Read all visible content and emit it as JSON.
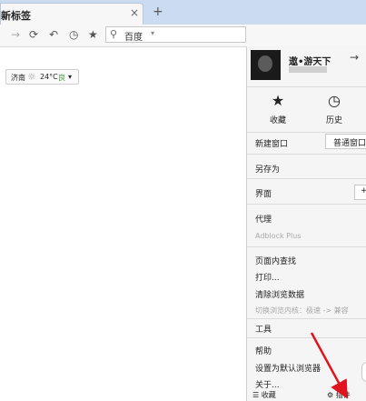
{
  "tab": {
    "title": "新标签",
    "close": "×",
    "new_tab": "+"
  },
  "toolbar": {
    "forward_icon": "→",
    "refresh_icon": "⟳",
    "undo_icon": "↶",
    "history_icon": "◷",
    "favorite_icon": "★",
    "search_icon": "⚲",
    "search_engine": "百度",
    "search_caret": "▾"
  },
  "weather": {
    "city": "济南",
    "icon": "☼",
    "temp": "24°C",
    "quality": "良",
    "caret": "▾"
  },
  "menu": {
    "profile": {
      "name": "遨•游天下",
      "arrow": "→"
    },
    "quick": [
      {
        "icon": "★",
        "label": "收藏"
      },
      {
        "icon": "◷",
        "label": "历史"
      }
    ],
    "new_window": "新建窗口",
    "mode": "普通窗口",
    "save_as": "另存为",
    "interface": "界面",
    "interface_btn": "+",
    "proxy": "代理",
    "adblock": "Adblock Plus",
    "find": "页面内查找",
    "print": "打印...",
    "clear": "清除浏览数据",
    "kernel": "切换浏览内核：极速 -> 兼容",
    "tools": "工具",
    "help": "帮助",
    "default_browser": "设置为默认浏览器",
    "about": "关于...",
    "footer": {
      "left": "☰ 收藏",
      "right": "⚙ 插件"
    }
  },
  "colors": {
    "arrow": "#e0141e",
    "good": "#3a9a3a"
  }
}
